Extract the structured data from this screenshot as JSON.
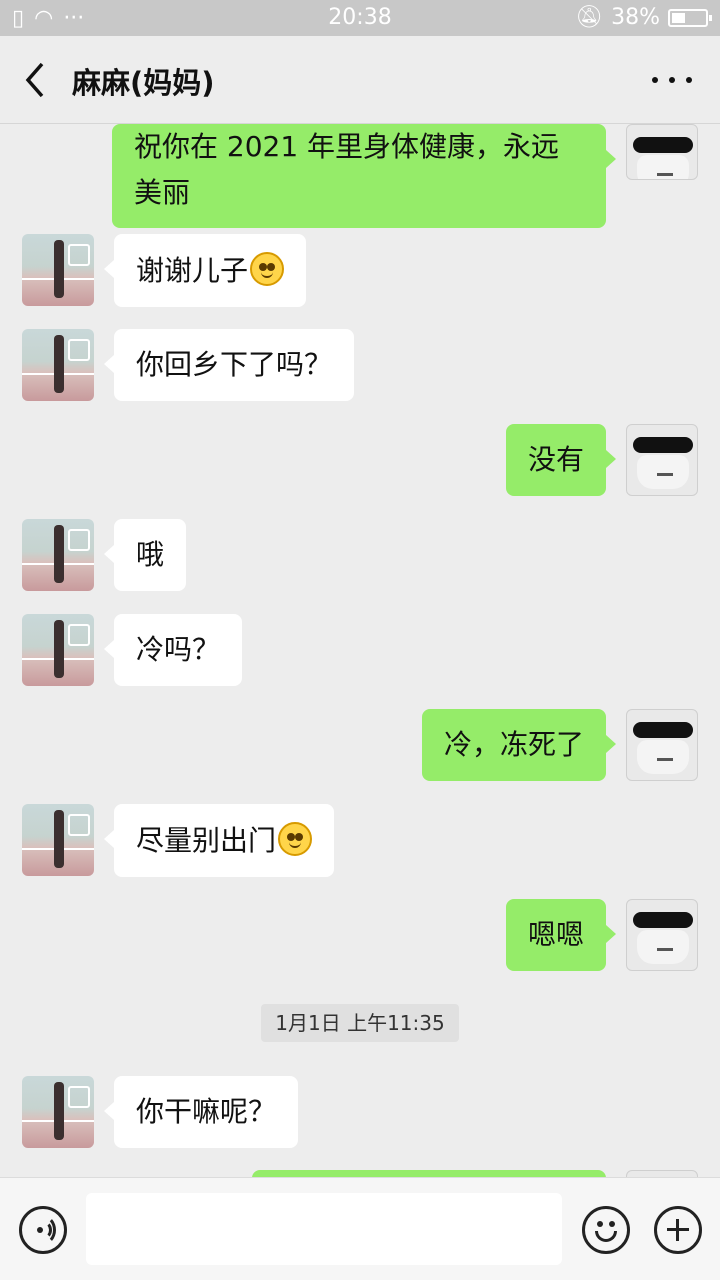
{
  "status_bar": {
    "time": "20:38",
    "battery": "38%",
    "battery_level": 0.38,
    "left_icons": [
      "sim-alert-icon",
      "wifi-icon",
      "more-dots-icon"
    ],
    "right_icons": [
      "silent-bell-icon",
      "battery-icon"
    ]
  },
  "header": {
    "title": "麻麻(妈妈)",
    "back_icon": "chevron-left-icon",
    "more_icon": "more-horizontal-icon"
  },
  "chat": {
    "messages": [
      {
        "from": "me",
        "text": "祝你在 2021 年里身体健康，永远美丽"
      },
      {
        "from": "mom",
        "text": "谢谢儿子",
        "emoji": "smile"
      },
      {
        "from": "mom",
        "text": "你回乡下了吗？"
      },
      {
        "from": "me",
        "text": "没有"
      },
      {
        "from": "mom",
        "text": "哦"
      },
      {
        "from": "mom",
        "text": "冷吗？"
      },
      {
        "from": "me",
        "text": "冷，冻死了"
      },
      {
        "from": "mom",
        "text": "尽量别出门",
        "emoji": "smile"
      },
      {
        "from": "me",
        "text": "嗯嗯"
      },
      {
        "from": "mom",
        "text": "你干嘛呢？"
      }
    ],
    "timestamp": "1月1日 上午11:35"
  },
  "input_bar": {
    "value": "",
    "icons": [
      "voice-icon",
      "emoji-icon",
      "plus-icon"
    ]
  },
  "colors": {
    "outgoing_bubble": "#95ec69",
    "incoming_bubble": "#ffffff",
    "background": "#ededed"
  }
}
